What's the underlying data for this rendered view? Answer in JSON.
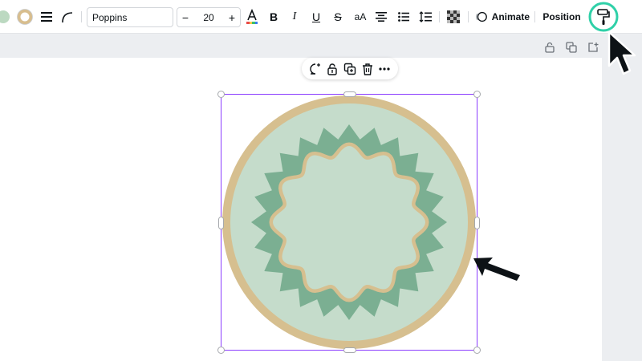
{
  "toolbar": {
    "font_name": "Poppins",
    "font_size": "20",
    "size_minus": "−",
    "size_plus": "+",
    "bold_glyph": "B",
    "italic_glyph": "I",
    "underline_glyph": "U",
    "strike_glyph": "S",
    "case_glyph": "aA",
    "animate_label": "Animate",
    "position_label": "Position"
  },
  "colors": {
    "fill_swatch": "#bcd9c1",
    "outline_swatch": "#d8be8e",
    "selection": "#8b3dff",
    "highlight_ring": "#2fd0a8",
    "circle_outer": "#d6bf8f",
    "circle_inner": "#c5dccb",
    "star_band": "#7baf92"
  }
}
